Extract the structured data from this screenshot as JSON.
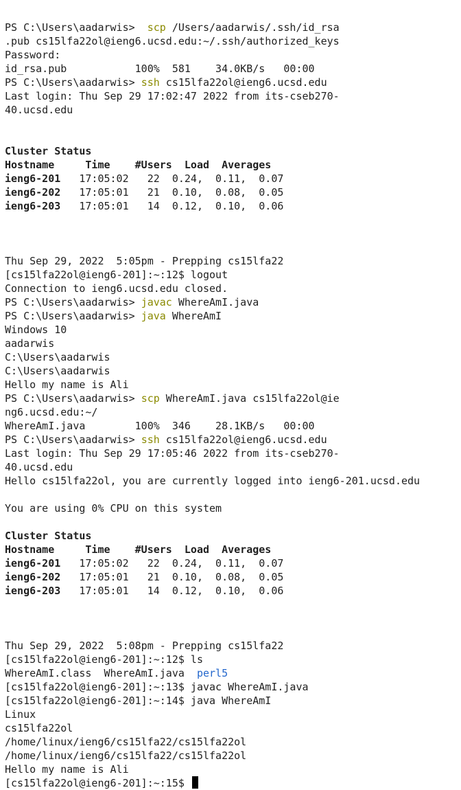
{
  "terminal": {
    "colors": {
      "background": "#ffffff",
      "text": "#1f1f1f",
      "command": "#8a8a00",
      "directory": "#2266cc",
      "cursor": "#000000"
    },
    "lines": [
      {
        "segments": [
          {
            "t": "PS C:\\Users\\aadarwis>  "
          },
          {
            "t": "scp",
            "c": "cmd"
          },
          {
            "t": " /Users/aadarwis/.ssh/id_rsa"
          }
        ]
      },
      {
        "segments": [
          {
            "t": ".pub cs15lfa22ol@ieng6.ucsd.edu:~/.ssh/authorized_keys"
          }
        ]
      },
      {
        "segments": [
          {
            "t": "Password:"
          }
        ]
      },
      {
        "segments": [
          {
            "t": "id_rsa.pub           100%  581    34.0KB/s   00:00"
          }
        ]
      },
      {
        "segments": [
          {
            "t": "PS C:\\Users\\aadarwis> "
          },
          {
            "t": "ssh",
            "c": "cmd"
          },
          {
            "t": " cs15lfa22ol@ieng6.ucsd.edu"
          }
        ]
      },
      {
        "segments": [
          {
            "t": "Last login: Thu Sep 29 17:02:47 2022 from its-cseb270-"
          }
        ]
      },
      {
        "segments": [
          {
            "t": "40.ucsd.edu"
          }
        ]
      },
      {
        "segments": [
          {
            "t": ""
          }
        ]
      },
      {
        "segments": [
          {
            "t": ""
          }
        ]
      },
      {
        "segments": [
          {
            "t": "Cluster Status",
            "c": "bold"
          }
        ]
      },
      {
        "segments": [
          {
            "t": "Hostname     Time    #Users  Load  Averages",
            "c": "bold"
          }
        ]
      },
      {
        "segments": [
          {
            "t": "ieng6-201",
            "c": "bold"
          },
          {
            "t": "   17:05:02   22  0.24,  0.11,  0.07"
          }
        ]
      },
      {
        "segments": [
          {
            "t": "ieng6-202",
            "c": "bold"
          },
          {
            "t": "   17:05:01   21  0.10,  0.08,  0.05"
          }
        ]
      },
      {
        "segments": [
          {
            "t": "ieng6-203",
            "c": "bold"
          },
          {
            "t": "   17:05:01   14  0.12,  0.10,  0.06"
          }
        ]
      },
      {
        "segments": [
          {
            "t": ""
          }
        ]
      },
      {
        "segments": [
          {
            "t": ""
          }
        ]
      },
      {
        "segments": [
          {
            "t": ""
          }
        ]
      },
      {
        "segments": [
          {
            "t": "Thu Sep 29, 2022  5:05pm - Prepping cs15lfa22"
          }
        ]
      },
      {
        "segments": [
          {
            "t": "[cs15lfa22ol@ieng6-201]:~:12$ logout"
          }
        ]
      },
      {
        "segments": [
          {
            "t": "Connection to ieng6.ucsd.edu closed."
          }
        ]
      },
      {
        "segments": [
          {
            "t": "PS C:\\Users\\aadarwis> "
          },
          {
            "t": "javac",
            "c": "cmd"
          },
          {
            "t": " WhereAmI.java"
          }
        ]
      },
      {
        "segments": [
          {
            "t": "PS C:\\Users\\aadarwis> "
          },
          {
            "t": "java",
            "c": "cmd"
          },
          {
            "t": " WhereAmI"
          }
        ]
      },
      {
        "segments": [
          {
            "t": "Windows 10"
          }
        ]
      },
      {
        "segments": [
          {
            "t": "aadarwis"
          }
        ]
      },
      {
        "segments": [
          {
            "t": "C:\\Users\\aadarwis"
          }
        ]
      },
      {
        "segments": [
          {
            "t": "C:\\Users\\aadarwis"
          }
        ]
      },
      {
        "segments": [
          {
            "t": "Hello my name is Ali"
          }
        ]
      },
      {
        "segments": [
          {
            "t": "PS C:\\Users\\aadarwis> "
          },
          {
            "t": "scp",
            "c": "cmd"
          },
          {
            "t": " WhereAmI.java cs15lfa22ol@ie"
          }
        ]
      },
      {
        "segments": [
          {
            "t": "ng6.ucsd.edu:~/"
          }
        ]
      },
      {
        "segments": [
          {
            "t": "WhereAmI.java        100%  346    28.1KB/s   00:00"
          }
        ]
      },
      {
        "segments": [
          {
            "t": "PS C:\\Users\\aadarwis> "
          },
          {
            "t": "ssh",
            "c": "cmd"
          },
          {
            "t": " cs15lfa22ol@ieng6.ucsd.edu"
          }
        ]
      },
      {
        "segments": [
          {
            "t": "Last login: Thu Sep 29 17:05:46 2022 from its-cseb270-"
          }
        ]
      },
      {
        "segments": [
          {
            "t": "40.ucsd.edu"
          }
        ]
      },
      {
        "segments": [
          {
            "t": "Hello cs15lfa22ol, you are currently logged into ieng6-201.ucsd.edu"
          }
        ]
      },
      {
        "segments": [
          {
            "t": ""
          }
        ]
      },
      {
        "segments": [
          {
            "t": "You are using 0% CPU on this system"
          }
        ]
      },
      {
        "segments": [
          {
            "t": ""
          }
        ]
      },
      {
        "segments": [
          {
            "t": "Cluster Status",
            "c": "bold"
          }
        ]
      },
      {
        "segments": [
          {
            "t": "Hostname     Time    #Users  Load  Averages",
            "c": "bold"
          }
        ]
      },
      {
        "segments": [
          {
            "t": "ieng6-201",
            "c": "bold"
          },
          {
            "t": "   17:05:02   22  0.24,  0.11,  0.07"
          }
        ]
      },
      {
        "segments": [
          {
            "t": "ieng6-202",
            "c": "bold"
          },
          {
            "t": "   17:05:01   21  0.10,  0.08,  0.05"
          }
        ]
      },
      {
        "segments": [
          {
            "t": "ieng6-203",
            "c": "bold"
          },
          {
            "t": "   17:05:01   14  0.12,  0.10,  0.06"
          }
        ]
      },
      {
        "segments": [
          {
            "t": ""
          }
        ]
      },
      {
        "segments": [
          {
            "t": ""
          }
        ]
      },
      {
        "segments": [
          {
            "t": ""
          }
        ]
      },
      {
        "segments": [
          {
            "t": "Thu Sep 29, 2022  5:08pm - Prepping cs15lfa22"
          }
        ]
      },
      {
        "segments": [
          {
            "t": "[cs15lfa22ol@ieng6-201]:~:12$ ls"
          }
        ]
      },
      {
        "segments": [
          {
            "t": "WhereAmI.class  WhereAmI.java  "
          },
          {
            "t": "perl5",
            "c": "dir"
          }
        ]
      },
      {
        "segments": [
          {
            "t": "[cs15lfa22ol@ieng6-201]:~:13$ javac WhereAmI.java"
          }
        ]
      },
      {
        "segments": [
          {
            "t": "[cs15lfa22ol@ieng6-201]:~:14$ java WhereAmI"
          }
        ]
      },
      {
        "segments": [
          {
            "t": "Linux"
          }
        ]
      },
      {
        "segments": [
          {
            "t": "cs15lfa22ol"
          }
        ]
      },
      {
        "segments": [
          {
            "t": "/home/linux/ieng6/cs15lfa22/cs15lfa22ol"
          }
        ]
      },
      {
        "segments": [
          {
            "t": "/home/linux/ieng6/cs15lfa22/cs15lfa22ol"
          }
        ]
      },
      {
        "segments": [
          {
            "t": "Hello my name is Ali"
          }
        ]
      },
      {
        "segments": [
          {
            "t": "[cs15lfa22ol@ieng6-201]:~:15$ "
          }
        ],
        "cursor": true
      }
    ]
  }
}
